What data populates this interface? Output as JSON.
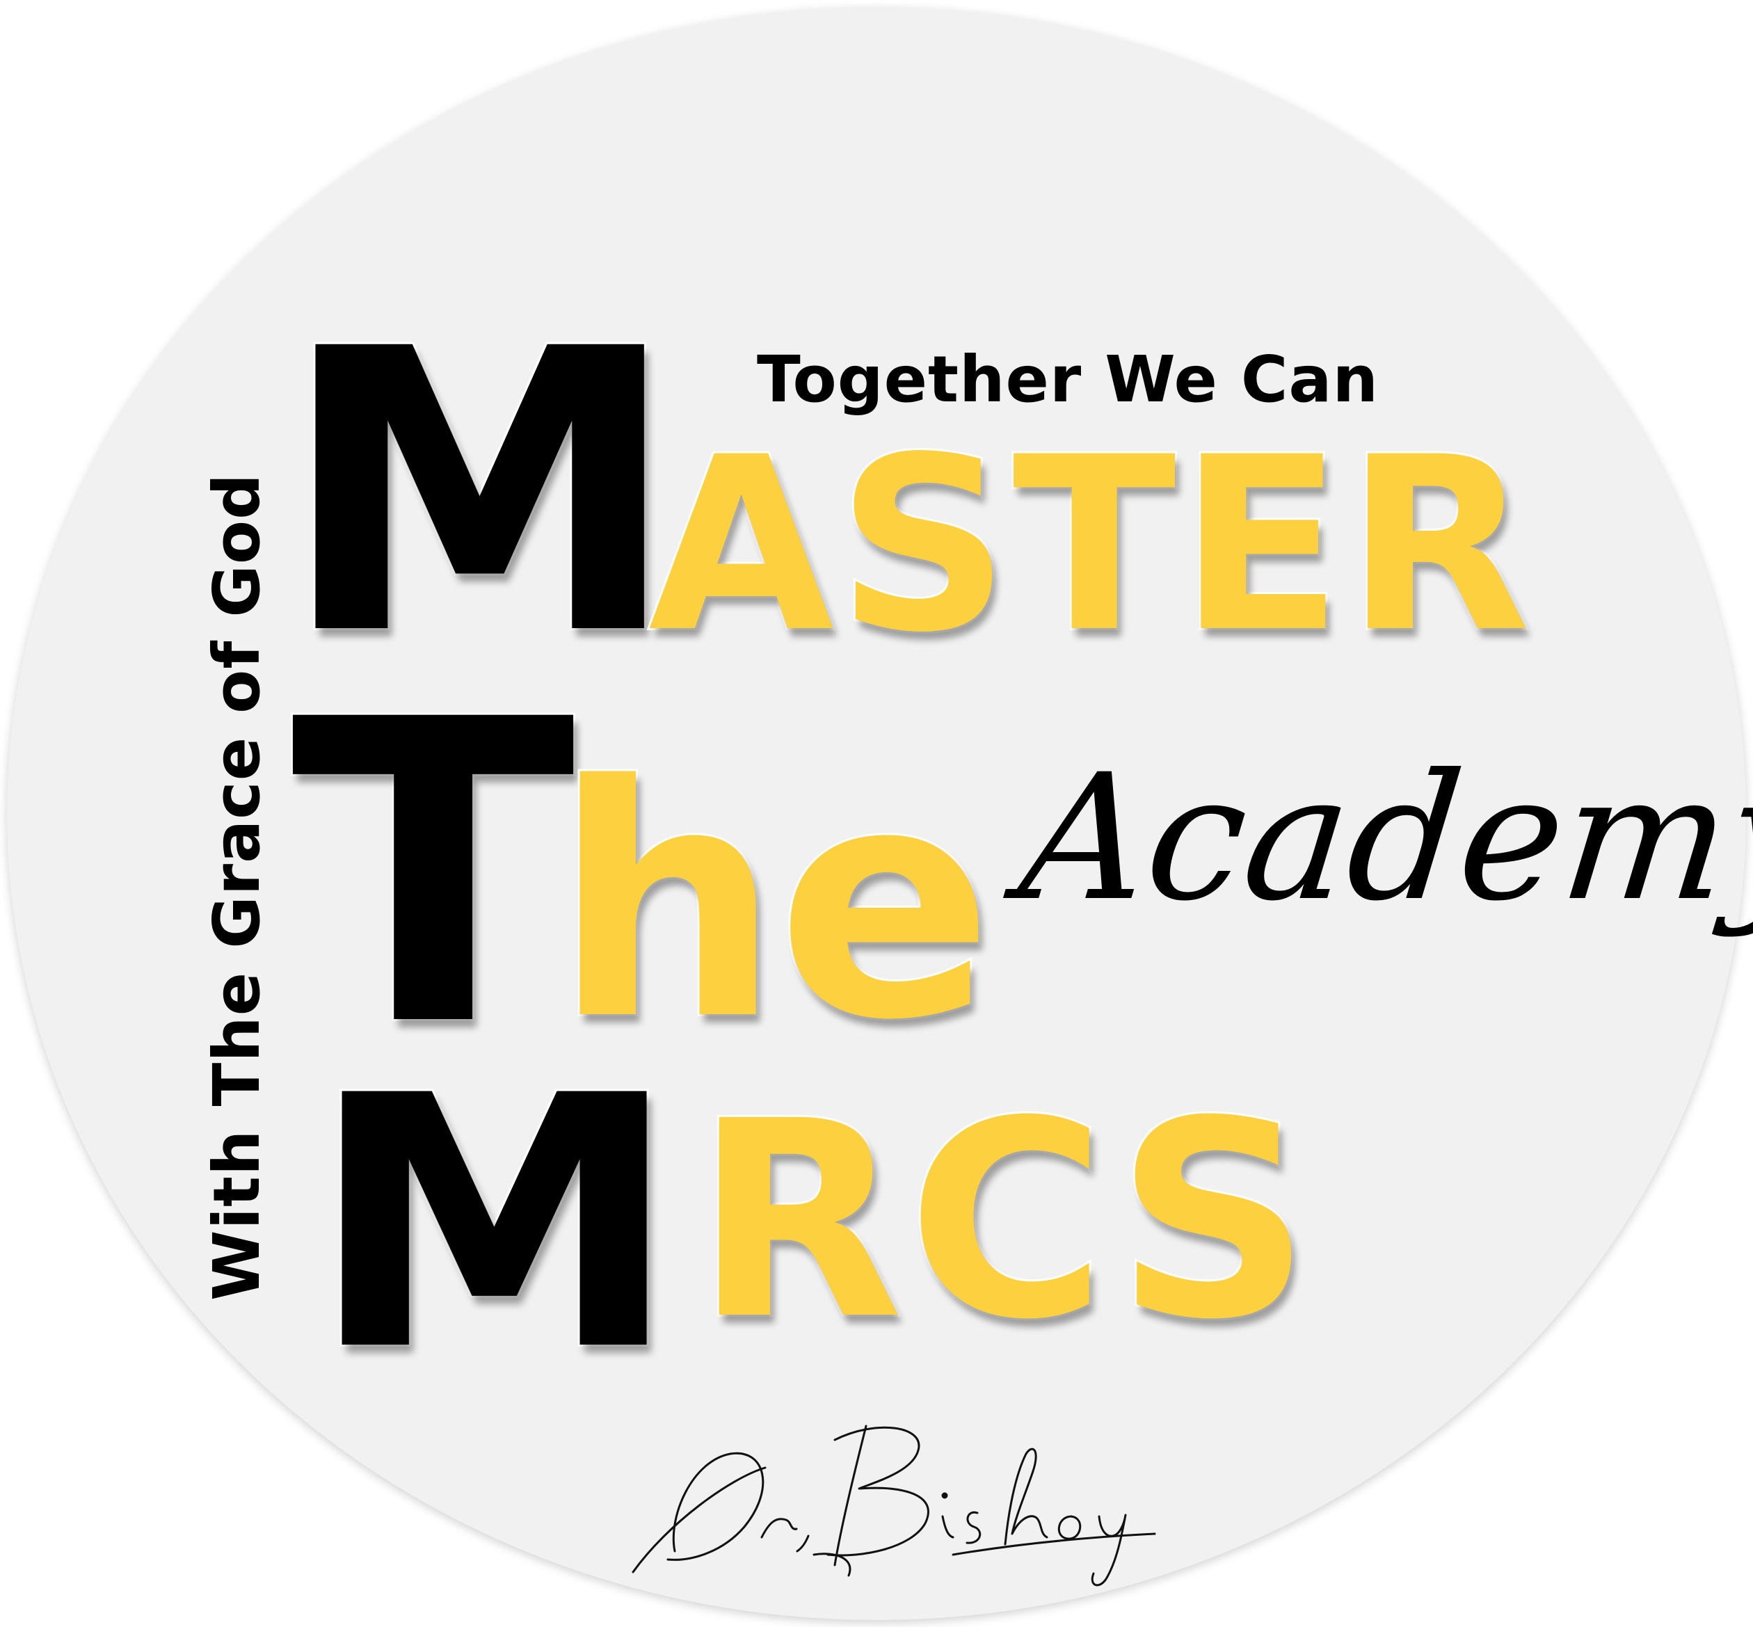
{
  "logo": {
    "tagline": "Together We Can",
    "vertical_tagline": "With The Grace of God",
    "line1": {
      "initial": "M",
      "rest": "ASTER"
    },
    "line2": {
      "initial": "T",
      "rest": "he"
    },
    "line3": {
      "initial": "M",
      "rest": "RCS"
    },
    "script_word": "Academy",
    "signature": "Dr. Bishoy"
  },
  "colors": {
    "background_circle": "#f1f1f1",
    "primary_black": "#000000",
    "accent_yellow": "#fdd03f",
    "outline_white": "#ffffff"
  }
}
